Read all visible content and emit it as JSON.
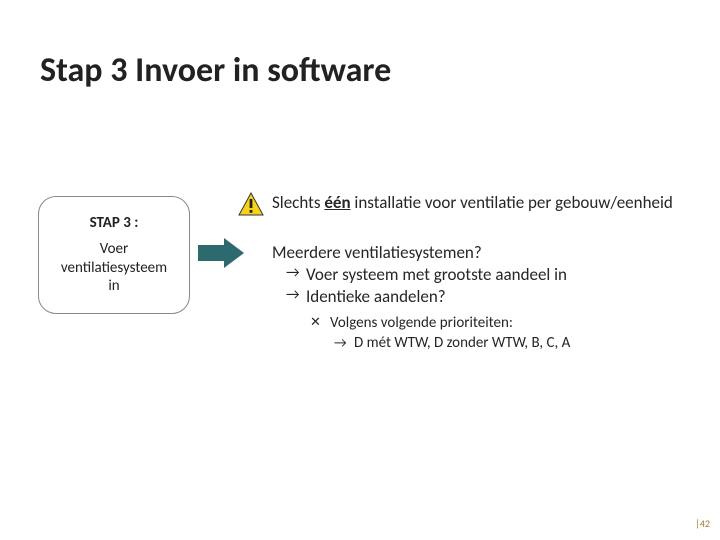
{
  "title": "Stap 3 Invoer in software",
  "stepbox": {
    "label": "STAP 3 :",
    "desc_line1": "Voer",
    "desc_line2": "ventilatiesysteem",
    "desc_line3": "in"
  },
  "warning": {
    "pre": "Slechts ",
    "emph": "één",
    "post": " installatie voor ventilatie per gebouw/eenheid"
  },
  "multi": {
    "q": "Meerdere ventilatiesystemen?",
    "a1": "Voer systeem met grootste aandeel in",
    "a2": "Identieke aandelen?",
    "x": "Volgens volgende prioriteiten:",
    "prio": "D mét WTW, D zonder WTW, B, C, A"
  },
  "pagenum": "|42"
}
